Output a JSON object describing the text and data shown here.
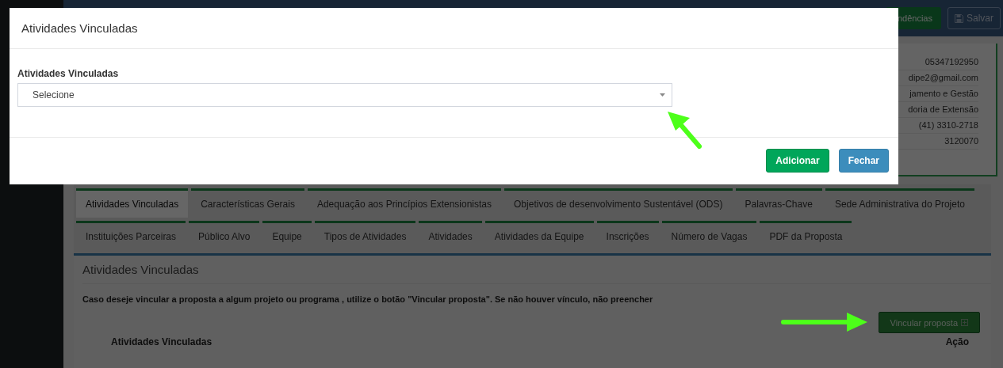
{
  "page": {
    "header_buttons": [
      {
        "label": "ndências",
        "kind": "success"
      },
      {
        "label": "Salvar",
        "kind": "save"
      }
    ],
    "info_lines": [
      "05347192950",
      "dipe2@gmail.com",
      "jamento e Gestão",
      "doria de Extensão",
      "(41) 3310-2718",
      "3120070"
    ],
    "tab_rows": [
      {
        "tabs": [
          {
            "label": "Atividades Vinculadas",
            "selected": true
          },
          {
            "label": "Características Gerais",
            "selected": false
          },
          {
            "label": "Adequação aos Princípios Extensionistas",
            "selected": false
          },
          {
            "label": "Objetivos de desenvolvimento Sustentável (ODS)",
            "selected": false
          },
          {
            "label": "Palavras-Chave",
            "selected": false
          },
          {
            "label": "Sede Administrativa do Projeto",
            "selected": false
          }
        ]
      },
      {
        "tabs": [
          {
            "label": "Instituições Parceiras",
            "selected": false
          },
          {
            "label": "Público Alvo",
            "selected": false
          },
          {
            "label": "Equipe",
            "selected": false
          },
          {
            "label": "Tipos de Atividades",
            "selected": false
          },
          {
            "label": "Atividades",
            "selected": false
          },
          {
            "label": "Atividades da Equipe",
            "selected": false
          },
          {
            "label": "Inscrições",
            "selected": false
          },
          {
            "label": "Número de Vagas",
            "selected": false
          },
          {
            "label": "PDF da Proposta",
            "selected": false
          }
        ]
      }
    ],
    "section": {
      "title": "Atividades Vinculadas",
      "instruction": "Caso deseje vincular a proposta a algum projeto ou programa , utilize o botão \"Vincular proposta\". Se não houver vínculo, não preencher",
      "button": {
        "label": "Vincular proposta",
        "highlighted_by_arrow": true
      },
      "columns": [
        "Atividades Vinculadas",
        "Ação"
      ]
    }
  },
  "modal": {
    "title": "Atividades Vinculadas",
    "field_label": "Atividades Vinculadas",
    "select": {
      "value": "Selecione",
      "highlighted_by_arrow": true
    },
    "buttons": [
      {
        "label": "Adicionar",
        "kind": "primary"
      },
      {
        "label": "Fechar",
        "kind": "secondary"
      }
    ]
  }
}
